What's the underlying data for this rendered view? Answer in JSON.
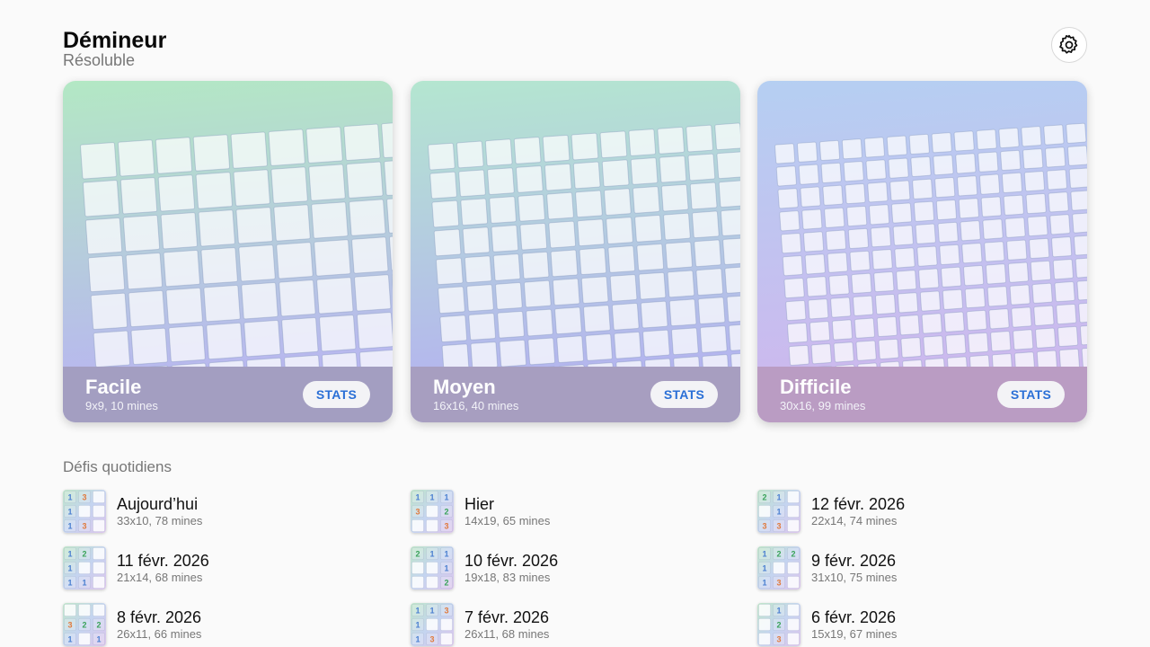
{
  "app": {
    "title": "Démineur",
    "subtitle": "Résoluble"
  },
  "settings": {
    "icon": "gear-icon"
  },
  "difficulties": [
    {
      "name": "Facile",
      "desc": "9x9, 10 mines",
      "stats_label": "STATS",
      "colors": {
        "top_left": "#b3e8c4",
        "bottom_left": "#b8b6f0",
        "footer": "#a39ec1"
      }
    },
    {
      "name": "Moyen",
      "desc": "16x16, 40 mines",
      "stats_label": "STATS",
      "colors": {
        "top_left": "#b4e6d0",
        "bottom_left": "#b4b4ef",
        "footer": "#a79ec0"
      }
    },
    {
      "name": "Difficile",
      "desc": "30x16, 99 mines",
      "stats_label": "STATS",
      "colors": {
        "top_left": "#b5cff2",
        "bottom_left": "#cdb8ee",
        "footer": "#ba9cc3"
      }
    }
  ],
  "daily": {
    "title": "Défis quotidiens",
    "items": [
      {
        "date": "Aujourd’hui",
        "desc": "33x10, 78 mines",
        "cells": [
          "1",
          "3",
          "",
          "1",
          "",
          "",
          "1",
          "3",
          ""
        ]
      },
      {
        "date": "Hier",
        "desc": "14x19, 65 mines",
        "cells": [
          "1",
          "1",
          "1",
          "3",
          "",
          "2",
          "",
          "",
          "3"
        ]
      },
      {
        "date": "12 févr. 2026",
        "desc": "22x14, 74 mines",
        "cells": [
          "2",
          "1",
          "",
          "",
          "1",
          "",
          "3",
          "3",
          ""
        ]
      },
      {
        "date": "11 févr. 2026",
        "desc": "21x14, 68 mines",
        "cells": [
          "1",
          "2",
          "",
          "1",
          "",
          "",
          "1",
          "1",
          ""
        ]
      },
      {
        "date": "10 févr. 2026",
        "desc": "19x18, 83 mines",
        "cells": [
          "2",
          "1",
          "1",
          "",
          "",
          "1",
          "",
          "",
          "2"
        ]
      },
      {
        "date": "9 févr. 2026",
        "desc": "31x10, 75 mines",
        "cells": [
          "1",
          "2",
          "2",
          "1",
          "",
          "",
          "1",
          "3",
          ""
        ]
      },
      {
        "date": "8 févr. 2026",
        "desc": "26x11, 66 mines",
        "cells": [
          "",
          "",
          "",
          "3",
          "2",
          "2",
          "1",
          "",
          "1"
        ]
      },
      {
        "date": "7 févr. 2026",
        "desc": "26x11, 68 mines",
        "cells": [
          "1",
          "1",
          "3",
          "1",
          "",
          "",
          "1",
          "3",
          ""
        ]
      },
      {
        "date": "6 févr. 2026",
        "desc": "15x19, 67 mines",
        "cells": [
          "",
          "1",
          "",
          "",
          "2",
          "",
          "",
          "3",
          ""
        ]
      }
    ]
  },
  "number_colors": {
    "1": "#4a7fd0",
    "2": "#3aa35a",
    "3": "#e07a3c"
  }
}
